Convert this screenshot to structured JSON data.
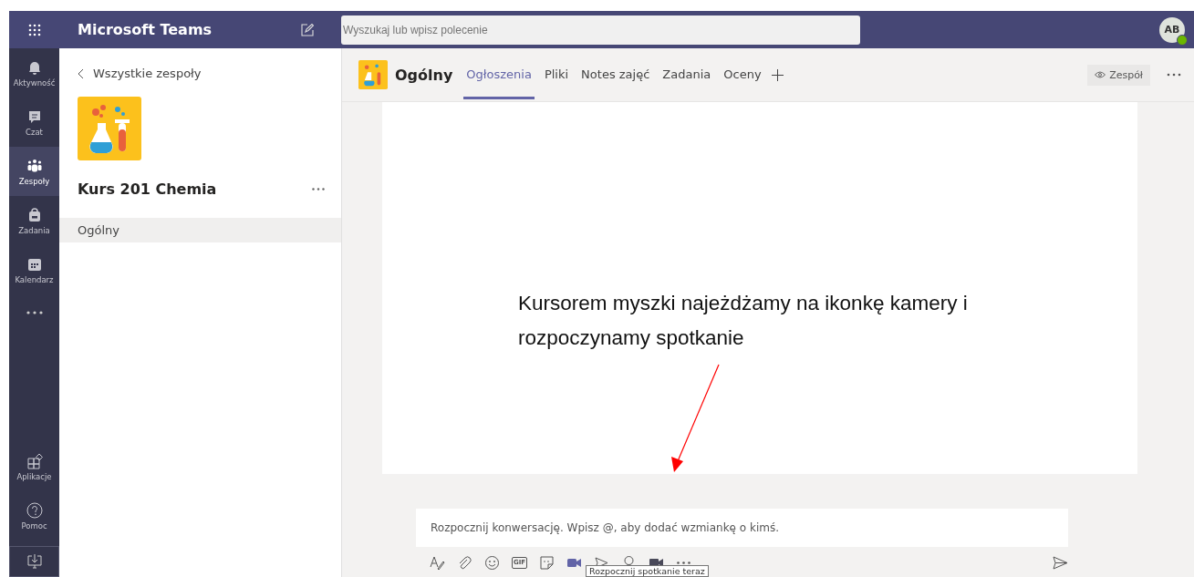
{
  "app": {
    "title": "Microsoft Teams",
    "avatar": "AB",
    "online": true
  },
  "search": {
    "placeholder": "Wyszukaj lub wpisz polecenie"
  },
  "rail": {
    "items": [
      {
        "label": "Aktywność",
        "kind": "bell",
        "selected": false
      },
      {
        "label": "Czat",
        "kind": "chat",
        "selected": false
      },
      {
        "label": "Zespoły",
        "kind": "teams",
        "selected": true
      },
      {
        "label": "Zadania",
        "kind": "bag",
        "selected": false
      },
      {
        "label": "Kalendarz",
        "kind": "calendar",
        "selected": false
      }
    ],
    "bottom": [
      {
        "label": "Aplikacje",
        "kind": "apps"
      },
      {
        "label": "Pomoc",
        "kind": "help"
      }
    ]
  },
  "sidebar": {
    "back": "Wszystkie zespoły",
    "team": "Kurs 201 Chemia",
    "channels": [
      {
        "label": "Ogólny",
        "selected": true
      }
    ]
  },
  "channel": {
    "name": "Ogólny",
    "tabs": [
      {
        "label": "Ogłoszenia",
        "selected": true
      },
      {
        "label": "Pliki",
        "selected": false
      },
      {
        "label": "Notes zajęć",
        "selected": false
      },
      {
        "label": "Zadania",
        "selected": false
      },
      {
        "label": "Oceny",
        "selected": false
      }
    ],
    "team_button": "Zespół"
  },
  "annotation": {
    "text": "Kursorem myszki najeżdżamy na ikonkę kamery i rozpoczynamy spotkanie"
  },
  "compose": {
    "placeholder": "Rozpocznij konwersację. Wpisz @, aby dodać wzmiankę o kimś.",
    "gif": "GIF",
    "tooltip": "Rozpocznij spotkanie teraz"
  }
}
